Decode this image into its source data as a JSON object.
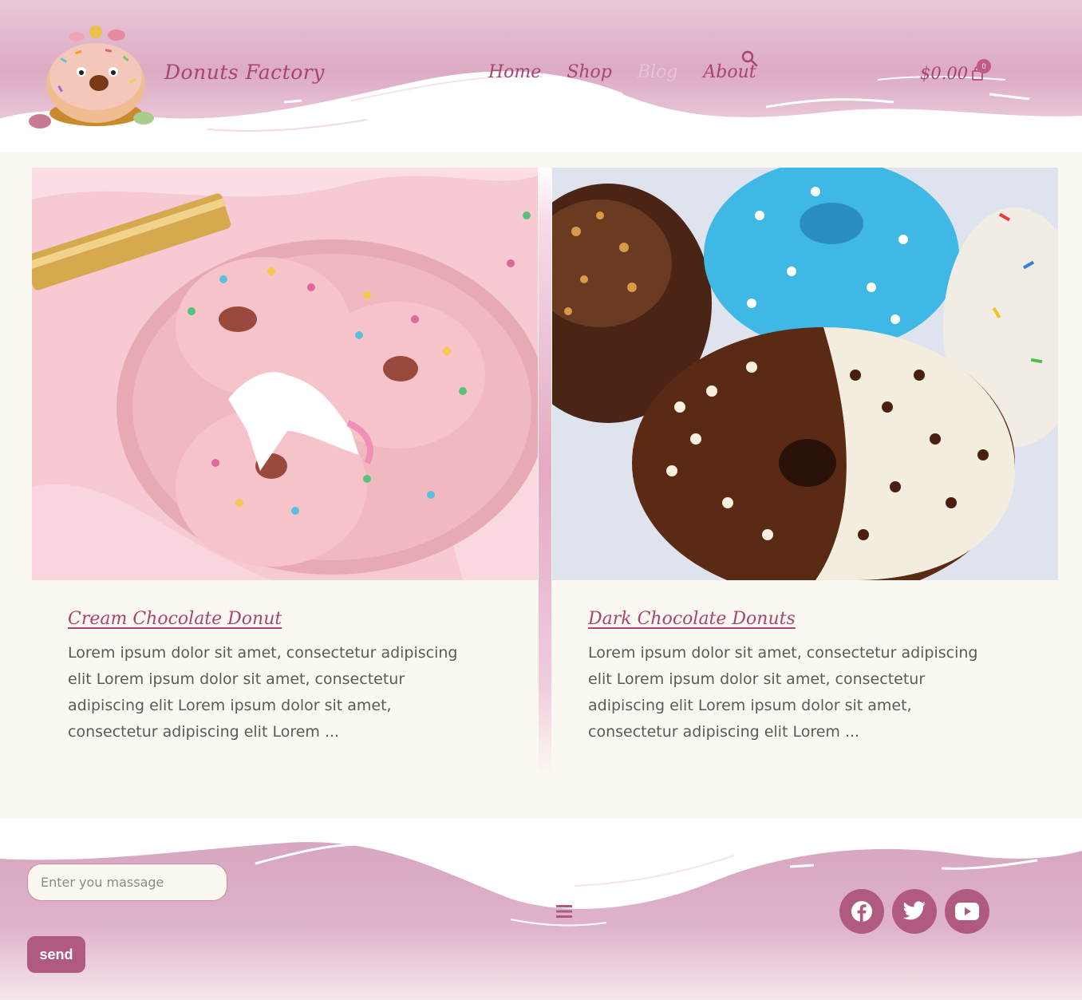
{
  "colors": {
    "brand": "#a8456f",
    "accent": "#b05a80",
    "header_bg": "#e6c3d4",
    "page_bg": "#fbf8f2"
  },
  "header": {
    "brand_name": "Donuts Factory",
    "nav": [
      "Home",
      "Shop",
      "Blog",
      "About"
    ],
    "search_icon": "search-icon",
    "cart": {
      "total": "$0.00",
      "count": "0",
      "icon": "shopping-bag-icon"
    }
  },
  "posts": [
    {
      "title": "Cream Chocolate Donut",
      "excerpt": "Lorem ipsum dolor sit amet, consectetur adipiscing elit Lorem ipsum dolor sit amet, consectetur adipiscing elit Lorem ipsum dolor sit amet, consectetur adipiscing elit Lorem ..."
    },
    {
      "title": "Dark Chocolate Donuts",
      "excerpt": "Lorem ipsum dolor sit amet, consectetur adipiscing elit Lorem ipsum dolor sit amet, consectetur adipiscing elit Lorem ipsum dolor sit amet, consectetur adipiscing elit Lorem ..."
    }
  ],
  "footer": {
    "message_placeholder": "Enter you massage",
    "send_label": "send",
    "menu_icon": "hamburger-menu-icon",
    "socials": [
      "facebook-icon",
      "twitter-icon",
      "youtube-icon"
    ]
  }
}
